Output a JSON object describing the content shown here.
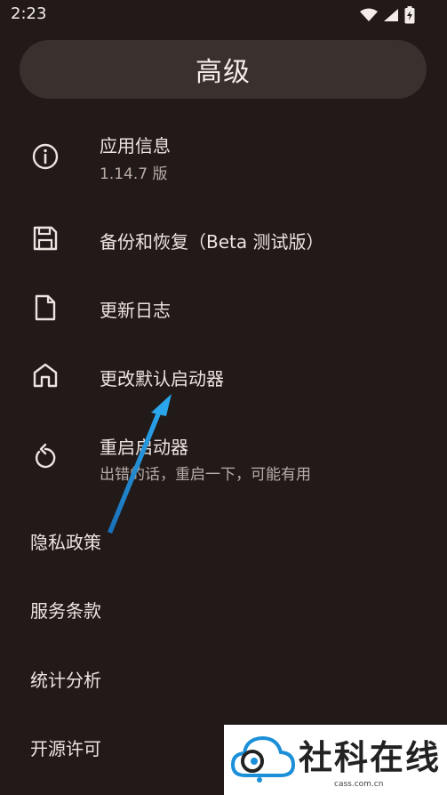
{
  "status_bar": {
    "time": "2:23"
  },
  "header": {
    "title": "高级"
  },
  "items": [
    {
      "label": "应用信息",
      "sub": "1.14.7 版",
      "icon": "info-icon"
    },
    {
      "label": "备份和恢复（Beta 测试版）",
      "icon": "save-icon"
    },
    {
      "label": "更新日志",
      "icon": "document-icon"
    },
    {
      "label": "更改默认启动器",
      "icon": "home-icon"
    },
    {
      "label": "重启启动器",
      "sub": "出错的话，重启一下，可能有用",
      "icon": "restart-icon"
    }
  ],
  "links": [
    {
      "label": "隐私政策"
    },
    {
      "label": "服务条款"
    },
    {
      "label": "统计分析"
    },
    {
      "label": "开源许可"
    }
  ],
  "watermark": {
    "text": "社科在线",
    "url": "cass.com.cn"
  },
  "colors": {
    "background": "#211a18",
    "header_bg": "#3a302d",
    "arrow": "#1f8fd6"
  }
}
